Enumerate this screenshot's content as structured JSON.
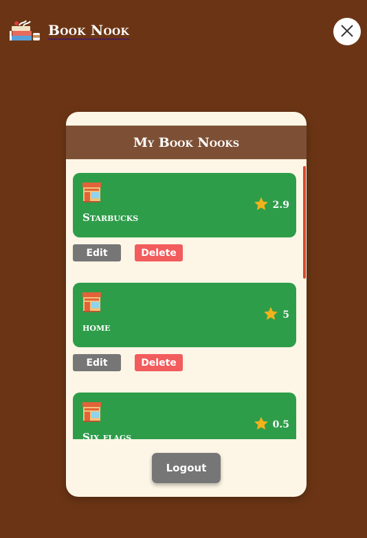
{
  "brand": {
    "name": "Book Nook",
    "icon": "books-coffee-icon"
  },
  "close_icon": "close-icon",
  "modal": {
    "title": "My Book Nooks",
    "logout_label": "Logout"
  },
  "nooks": [
    {
      "name": "Starbucks",
      "rating": "2.9",
      "edit_label": "Edit",
      "delete_label": "Delete"
    },
    {
      "name": "home",
      "rating": "5",
      "edit_label": "Edit",
      "delete_label": "Delete"
    },
    {
      "name": "Six flags",
      "rating": "0.5"
    }
  ],
  "colors": {
    "background": "#6b3515",
    "card_green": "#2e9d4a",
    "header_brown": "#7d5035",
    "delete_red": "#f25c5c",
    "edit_gray": "#767676",
    "star": "#f2b21b"
  }
}
